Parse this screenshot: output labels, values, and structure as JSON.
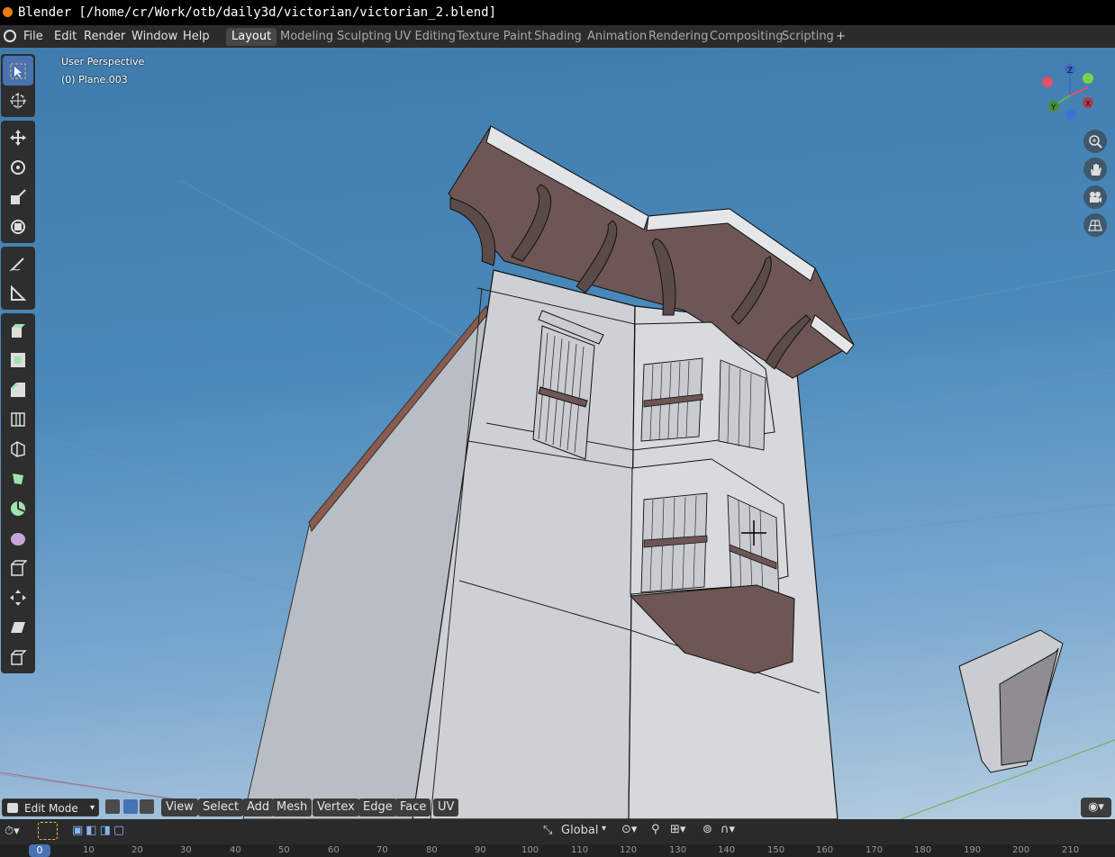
{
  "window": {
    "title": "Blender [/home/cr/Work/otb/daily3d/victorian/victorian_2.blend]"
  },
  "menu": {
    "items": [
      "File",
      "Edit",
      "Render",
      "Window",
      "Help"
    ]
  },
  "workspaces": {
    "tabs": [
      "Layout",
      "Modeling",
      "Sculpting",
      "UV Editing",
      "Texture Paint",
      "Shading",
      "Animation",
      "Rendering",
      "Compositing",
      "Scripting"
    ],
    "active": "Layout",
    "add_label": "+"
  },
  "viewport": {
    "view_name": "User Perspective",
    "object_info": "(0) Plane.003"
  },
  "gizmo": {
    "x": "X",
    "y": "Y",
    "z": "Z"
  },
  "toolbar": {
    "tools": [
      "select-box-icon",
      "cursor-icon",
      "move-icon",
      "rotate-icon",
      "scale-icon",
      "transform-icon",
      "annotate-icon",
      "measure-icon",
      "extrude-region-icon",
      "inset-faces-icon",
      "bevel-icon",
      "loop-cut-icon",
      "knife-icon",
      "poly-build-icon",
      "spin-icon",
      "smooth-icon",
      "edge-slide-icon",
      "shrink-fatten-icon",
      "shear-icon",
      "rip-region-icon"
    ]
  },
  "header": {
    "mode": "Edit Mode",
    "menus": [
      "View",
      "Select",
      "Add",
      "Mesh",
      "Vertex",
      "Edge",
      "Face",
      "UV"
    ]
  },
  "timeline": {
    "orientation": "Global",
    "current_frame": "0",
    "ticks": [
      "10",
      "20",
      "30",
      "40",
      "50",
      "60",
      "70",
      "80",
      "90",
      "100",
      "110",
      "120",
      "130",
      "140",
      "150",
      "160",
      "170",
      "180",
      "190",
      "200",
      "210"
    ]
  },
  "colors": {
    "accent": "#4772b3",
    "building_face": "#cfd2d6",
    "roof_underside": "#6d5654"
  }
}
